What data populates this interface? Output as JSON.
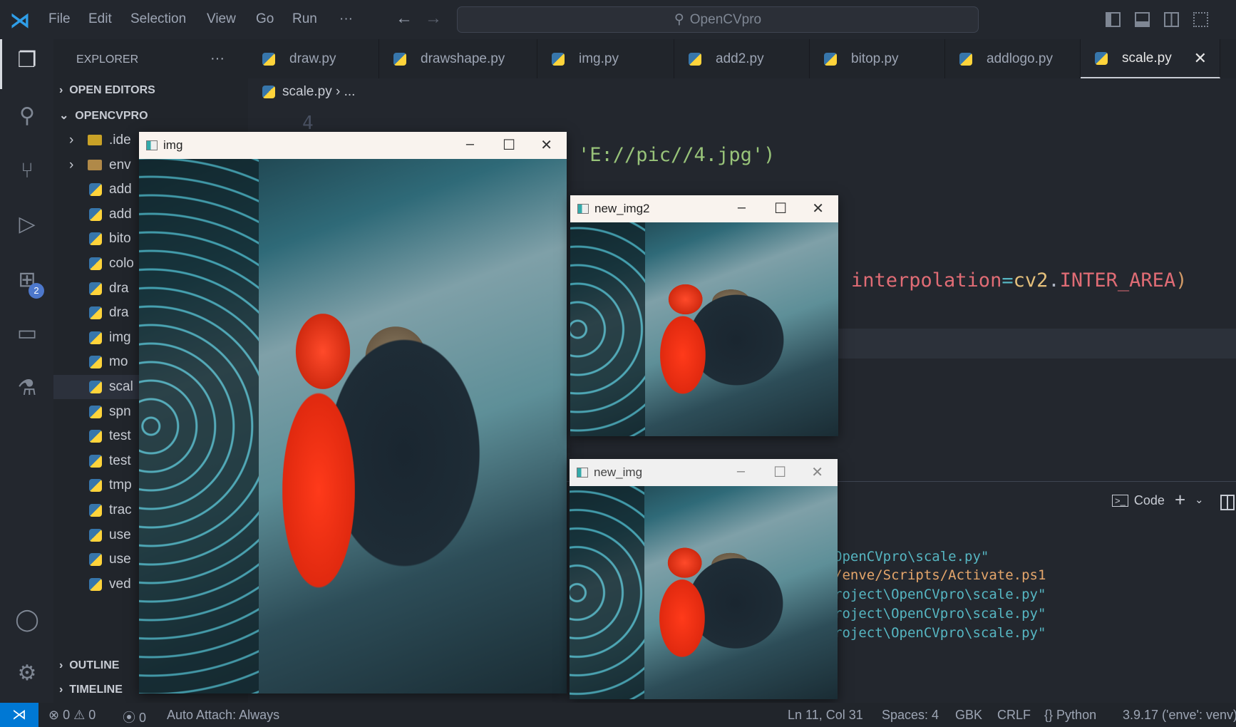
{
  "titlebar": {
    "menu": [
      "File",
      "Edit",
      "Selection",
      "View",
      "Go",
      "Run",
      "···"
    ],
    "search": "OpenCVpro",
    "back": "←",
    "forward": "→"
  },
  "activity": {
    "badge": "2"
  },
  "sidebar": {
    "title": "EXPLORER",
    "more": "···",
    "open_editors": "OPEN EDITORS",
    "project": "OPENCVPRO",
    "items": [
      ".ide",
      "env",
      "add",
      "add",
      "bito",
      "colo",
      "dra",
      "dra",
      "img",
      "mo",
      "scal",
      "spn",
      "test",
      "test",
      "tmp",
      "trac",
      "use",
      "use",
      "ved"
    ],
    "outline": "OUTLINE",
    "timeline": "TIMELINE"
  },
  "tabs": [
    "draw.py",
    "drawshape.py",
    "img.py",
    "add2.py",
    "bitop.py",
    "addlogo.py",
    "scale.py"
  ],
  "breadcrumb": {
    "file": "scale.py",
    "rest": "..."
  },
  "editor": {
    "line_number": "4",
    "line1": "'E://pic//4.jpg')",
    "line2_a": "interpolation",
    "line2_b": "=",
    "line2_c": "cv2",
    "line2_d": ".",
    "line2_e": "INTER_AREA",
    "line2_f": ")"
  },
  "terminal": {
    "label": "Code",
    "lines": [
      "OpenCVpro\\scale.py\"",
      "/enve/Scripts/Activate.ps1",
      "roject\\OpenCVpro\\scale.py\"",
      "roject\\OpenCVpro\\scale.py\"",
      "roject\\OpenCVpro\\scale.py\""
    ]
  },
  "windows": {
    "img": "img",
    "new_img2": "new_img2",
    "new_img": "new_img"
  },
  "status": {
    "errors": "0",
    "warnings": "0",
    "ports": "0",
    "auto_attach": "Auto Attach: Always",
    "position": "Ln 11, Col 31",
    "spaces": "Spaces: 4",
    "encoding": "GBK",
    "eol": "CRLF",
    "language": "Python",
    "interpreter": "3.9.17 ('enve': venv)"
  },
  "colors": {
    "accent": "#0078d4",
    "string": "#98c379",
    "keyword": "#e06c75",
    "class": "#e5c07b",
    "terminal": "#56b6c2"
  }
}
